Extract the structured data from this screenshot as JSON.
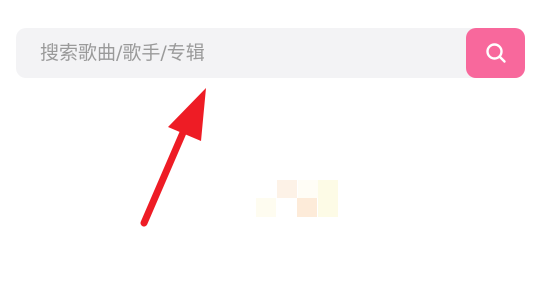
{
  "search": {
    "placeholder": "搜索歌曲/歌手/专辑",
    "value": "",
    "button_icon": "search-icon"
  },
  "colors": {
    "accent": "#f8689c",
    "search_bar_bg": "#f3f3f5",
    "placeholder_text": "#9a9a9a",
    "annotation_arrow": "#ee1c25",
    "background": "#ffffff"
  },
  "annotation": {
    "icon": "arrow-annotation-icon"
  },
  "loading": {
    "icon": "loading-placeholder-icon"
  }
}
